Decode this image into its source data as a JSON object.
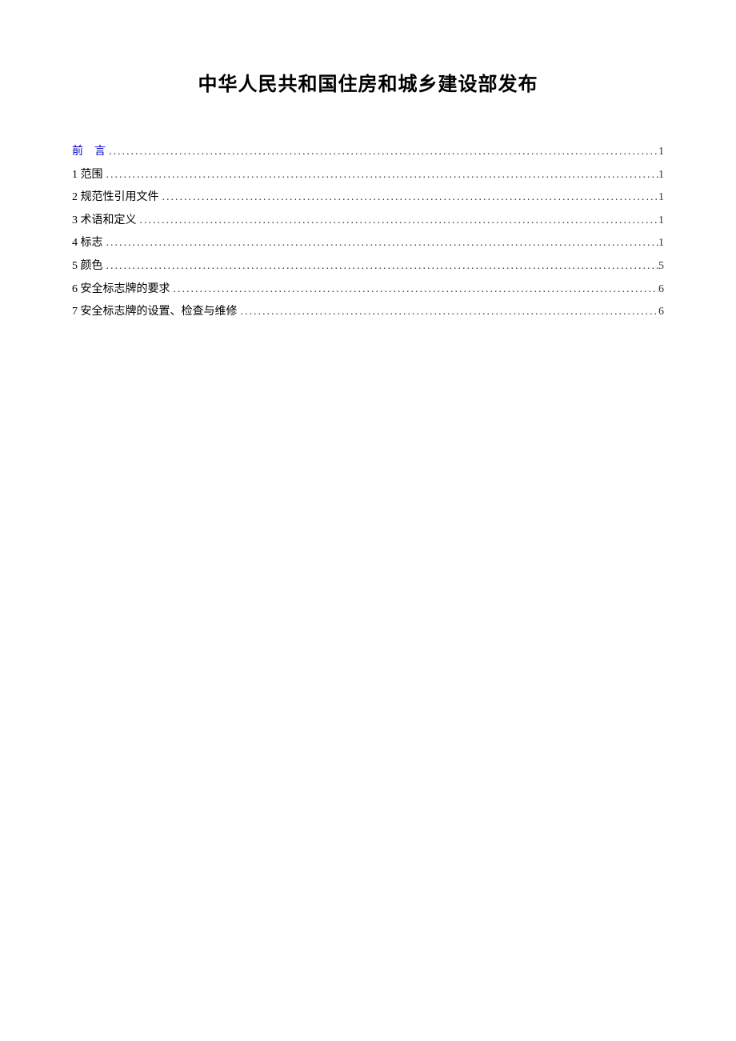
{
  "title": "中华人民共和国住房和城乡建设部发布",
  "toc": {
    "entries": [
      {
        "label": "前言",
        "page": "1",
        "isLink": true,
        "spaced": true
      },
      {
        "label": "1 范围",
        "page": "1",
        "isLink": false,
        "spaced": false
      },
      {
        "label": "2 规范性引用文件",
        "page": "1",
        "isLink": false,
        "spaced": false
      },
      {
        "label": "3 术语和定义",
        "page": "1",
        "isLink": false,
        "spaced": false
      },
      {
        "label": "4 标志",
        "page": "1",
        "isLink": false,
        "spaced": false
      },
      {
        "label": "5 颜色",
        "page": "5",
        "isLink": false,
        "spaced": false
      },
      {
        "label": "6 安全标志牌的要求",
        "page": "6",
        "isLink": false,
        "spaced": false
      },
      {
        "label": "7 安全标志牌的设置、检查与维修",
        "page": "6",
        "isLink": false,
        "spaced": false
      }
    ]
  }
}
